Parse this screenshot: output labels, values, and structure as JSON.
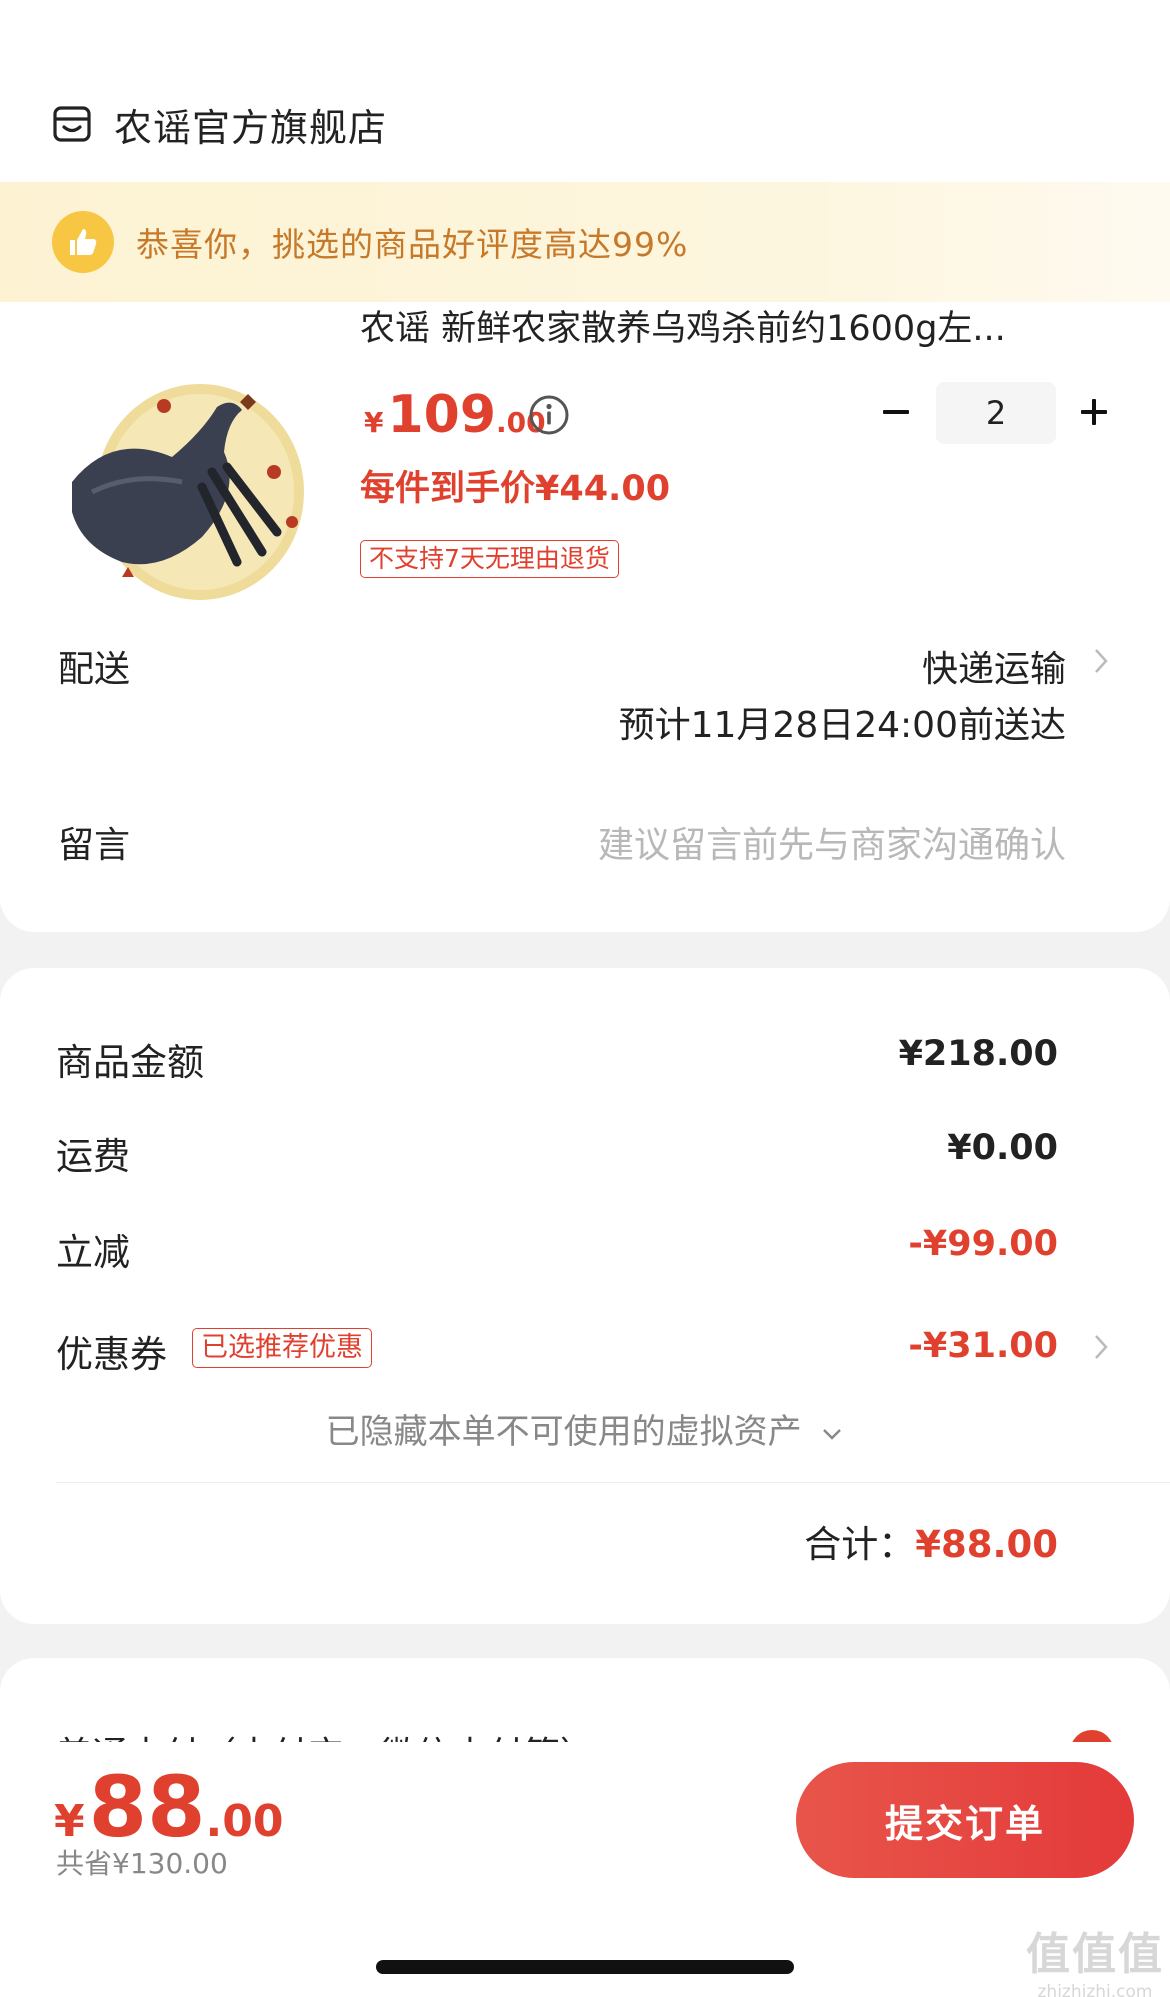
{
  "store": {
    "name": "农谣官方旗舰店"
  },
  "banner": {
    "text": "恭喜你，挑选的商品好评度高达99%"
  },
  "product": {
    "title": "农谣 新鲜农家散养乌鸡杀前约1600g左...",
    "price_currency": "¥",
    "price_int": "109",
    "price_dec": ".00",
    "unit_price": "每件到手价¥44.00",
    "return_tag": "不支持7天无理由退货",
    "quantity": "2"
  },
  "delivery": {
    "label": "配送",
    "method": "快递运输",
    "eta": "预计11月28日24:00前送达"
  },
  "message": {
    "label": "留言",
    "placeholder": "建议留言前先与商家沟通确认"
  },
  "summary": {
    "goods_label": "商品金额",
    "goods_value": "¥218.00",
    "shipping_label": "运费",
    "shipping_value": "¥0.00",
    "discount_label": "立减",
    "discount_value": "-¥99.00",
    "coupon_label": "优惠券",
    "coupon_tag": "已选推荐优惠",
    "coupon_value": "-¥31.00",
    "hidden_assets": "已隐藏本单不可使用的虚拟资产",
    "total_label": "合计：",
    "total_value": "¥88.00"
  },
  "payment": {
    "method_text": "普通支付（支付宝、微信支付等）"
  },
  "bottom": {
    "currency": "¥",
    "price_int": "88",
    "price_dec": ".00",
    "saved": "共省¥130.00",
    "submit_label": "提交订单"
  },
  "watermark": {
    "big": "值值值",
    "small": "zhizhizhi.com"
  },
  "colors": {
    "accent": "#e0412f",
    "banner_text": "#c7792a",
    "banner_bg": "#fdf3d3"
  }
}
